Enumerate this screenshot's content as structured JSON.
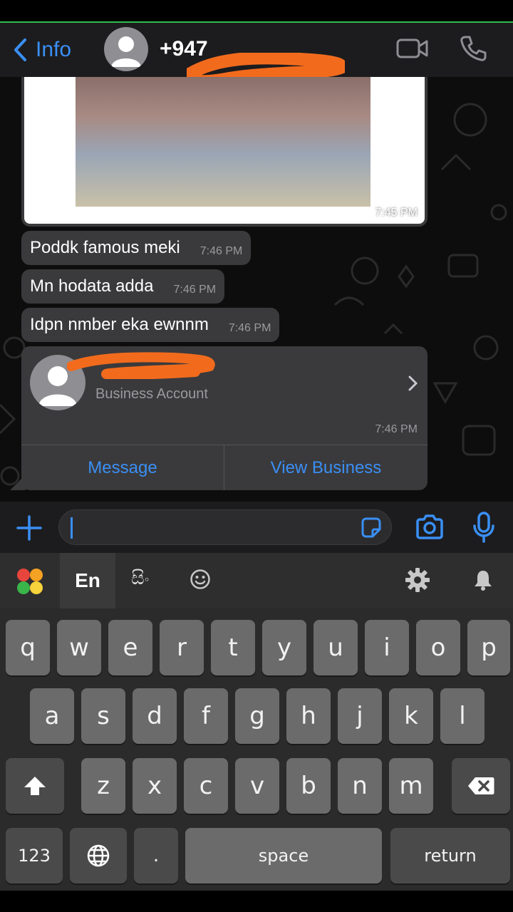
{
  "header": {
    "back_label": "Info",
    "contact_name": "+947"
  },
  "messages": [
    {
      "type": "image",
      "time": "7:45 PM"
    },
    {
      "type": "text",
      "text": "Poddk famous meki",
      "time": "7:46 PM"
    },
    {
      "type": "text",
      "text": "Mn hodata adda",
      "time": "7:46 PM"
    },
    {
      "type": "text",
      "text": "Idpn nmber eka ewnnm",
      "time": "7:46 PM"
    }
  ],
  "contact_card": {
    "subtitle": "Business Account",
    "time": "7:46 PM",
    "message_button": "Message",
    "view_business_button": "View Business"
  },
  "input": {
    "value": ""
  },
  "keyboard": {
    "lang_en": "En",
    "lang_si": "සිං",
    "row1": [
      "q",
      "w",
      "e",
      "r",
      "t",
      "y",
      "u",
      "i",
      "o",
      "p"
    ],
    "row2": [
      "a",
      "s",
      "d",
      "f",
      "g",
      "h",
      "j",
      "k",
      "l"
    ],
    "row3": [
      "z",
      "x",
      "c",
      "v",
      "b",
      "n",
      "m"
    ],
    "numbers_key": "123",
    "period_key": ".",
    "space_key": "space",
    "return_key": "return"
  },
  "colors": {
    "accent": "#3a8ff5",
    "bubble": "#3a3a3c",
    "redaction": "#f26b1d"
  },
  "icons": [
    "back-chevron-icon",
    "video-call-icon",
    "phone-call-icon",
    "chevron-right-icon",
    "plus-icon",
    "sticker-icon",
    "camera-icon",
    "microphone-icon",
    "keyboard-logo-icon",
    "emoji-icon",
    "gear-icon",
    "bell-icon",
    "shift-icon",
    "backspace-icon",
    "globe-icon"
  ]
}
